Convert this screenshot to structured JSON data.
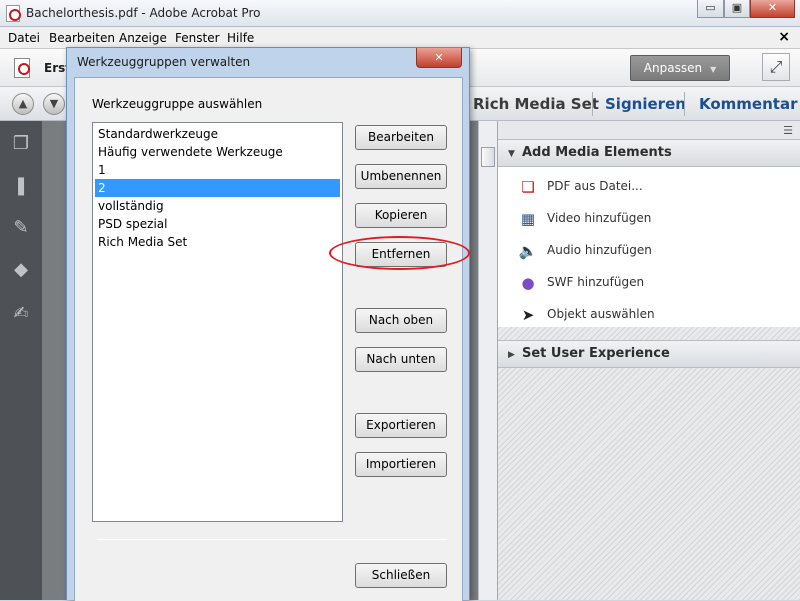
{
  "window": {
    "title": "Bachelorthesis.pdf - Adobe Acrobat Pro",
    "minimize_glyph": "▭",
    "maximize_glyph": "▣",
    "close_glyph": "✕"
  },
  "menubar": {
    "items": [
      "Datei",
      "Bearbeiten",
      "Anzeige",
      "Fenster",
      "Hilfe"
    ],
    "close_glyph": "×"
  },
  "toolbar": {
    "create_label": "Erst",
    "anpassen_label": "Anpassen",
    "anpassen_caret": "▼",
    "expand_glyph": "⤢",
    "nav_up_glyph": "▲",
    "nav_down_glyph": "▼"
  },
  "pane_tabs": [
    "Rich Media Set",
    "Signieren",
    "Kommentar"
  ],
  "leftnav": {
    "icons": [
      "pages-icon",
      "bookmark-icon",
      "attachment-icon",
      "layers-icon",
      "signature-icon"
    ],
    "glyphs": [
      "❐",
      "❚",
      "✎",
      "◆",
      "✍"
    ]
  },
  "right_panel": {
    "options_glyph": "☰",
    "section1": {
      "title": "Add Media Elements",
      "arrow": "▼",
      "tools": [
        {
          "label": "PDF aus Datei...",
          "icon": "pdf-file-icon",
          "glyph": "❏"
        },
        {
          "label": "Video hinzufügen",
          "icon": "video-icon",
          "glyph": "▦"
        },
        {
          "label": "Audio hinzufügen",
          "icon": "audio-icon",
          "glyph": "🔈"
        },
        {
          "label": "SWF hinzufügen",
          "icon": "swf-icon",
          "glyph": "●"
        },
        {
          "label": "Objekt auswählen",
          "icon": "select-arrow-icon",
          "glyph": "➤"
        }
      ]
    },
    "section2": {
      "title": "Set User Experience",
      "arrow": "▶"
    }
  },
  "dialog": {
    "title": "Werkzeuggruppen verwalten",
    "close_glyph": "✕",
    "label": "Werkzeuggruppe auswählen",
    "list_items": [
      "Standardwerkzeuge",
      "Häufig verwendete Werkzeuge",
      "1",
      "2",
      "vollständig",
      "PSD spezial",
      "Rich Media Set"
    ],
    "selected_index": 3,
    "buttons": {
      "edit": "Bearbeiten",
      "rename": "Umbenennen",
      "copy": "Kopieren",
      "remove": "Entfernen",
      "move_up": "Nach oben",
      "move_down": "Nach unten",
      "export": "Exportieren",
      "import": "Importieren",
      "close": "Schließen"
    }
  },
  "colors": {
    "selection": "#3399ff",
    "highlight": "#e31b23",
    "pane_tab": "#1d4f8f"
  }
}
